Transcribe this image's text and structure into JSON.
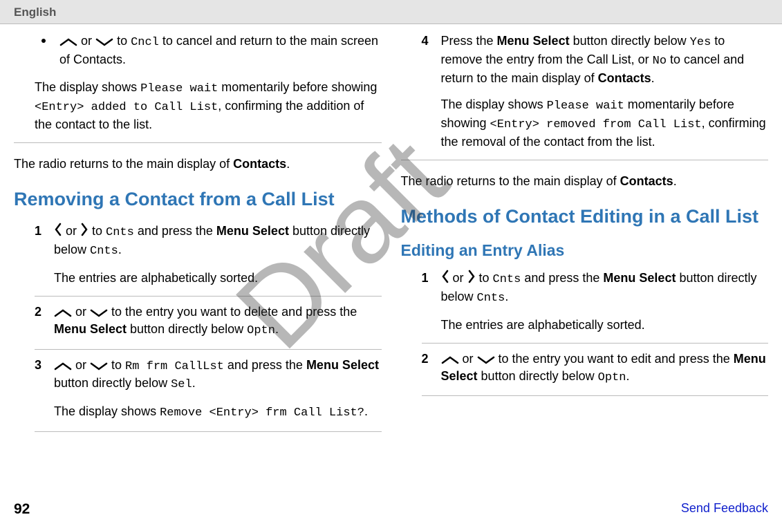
{
  "header": {
    "language": "English"
  },
  "watermark": "Draft",
  "left": {
    "bullet": {
      "pre": "or",
      "text1": " to ",
      "cncl": "Cncl",
      "text2": " to cancel and return to the main screen of Contacts."
    },
    "para1": {
      "t1": "The display shows ",
      "m1": "Please wait",
      "t2": " momentarily before showing ",
      "m2": "<Entry> added to Call List",
      "t3": ", confirming the addition of the contact to the list."
    },
    "returns": {
      "t1": "The radio returns to the main display of ",
      "c": "Contacts",
      "t2": "."
    },
    "h1": "Removing a Contact from a Call List",
    "s1": {
      "n": "1",
      "t1": " or ",
      "t2": " to ",
      "m1": "Cnts",
      "t3": " and press the ",
      "b1": "Menu Select",
      "t4": " button directly below ",
      "m2": "Cnts",
      "t5": ".",
      "p": "The entries are alphabetically sorted."
    },
    "s2": {
      "n": "2",
      "or": " or ",
      "t1": " to the entry you want to delete and press the ",
      "b1": "Menu Select",
      "t2": " button directly below ",
      "m1": "Optn",
      "t3": "."
    },
    "s3": {
      "n": "3",
      "or": " or ",
      "t1": " to ",
      "m1": "Rm frm CallLst",
      "t2": " and press the ",
      "b1": "Menu Select",
      "t3": " button directly below ",
      "m2": "Sel",
      "t4": ".",
      "pa": "The display shows ",
      "pm": "Remove <Entry> frm Call List?",
      "pb": "."
    }
  },
  "right": {
    "s4": {
      "n": "4",
      "t1": "Press the ",
      "b1": "Menu Select",
      "t2": " button directly below ",
      "m1": "Yes",
      "t3": " to remove the entry from the Call List, or ",
      "m2": "No",
      "t4": " to cancel and return to the main display of ",
      "b2": "Contacts",
      "t5": ".",
      "pa": "The display shows ",
      "pm1": "Please wait",
      "pb": " momentarily before showing ",
      "pm2": "<Entry> removed from Call List",
      "pc": ", confirming the removal of the contact from the list."
    },
    "returns": {
      "t1": "The radio returns to the main display of ",
      "c": "Contacts",
      "t2": "."
    },
    "h1": "Methods of Contact Editing in a Call List",
    "h2": "Editing an Entry Alias",
    "e1": {
      "n": "1",
      "t1": " or ",
      "t2": " to ",
      "m1": "Cnts",
      "t3": " and press the ",
      "b1": "Menu Select",
      "t4": " button directly below ",
      "m2": "Cnts",
      "t5": ".",
      "p": "The entries are alphabetically sorted."
    },
    "e2": {
      "n": "2",
      "or": " or ",
      "t1": " to the entry you want to edit and press the ",
      "b1": "Menu Select",
      "t2": " button directly below ",
      "m1": "Optn",
      "t3": "."
    }
  },
  "footer": {
    "page": "92",
    "feedback": "Send Feedback"
  }
}
